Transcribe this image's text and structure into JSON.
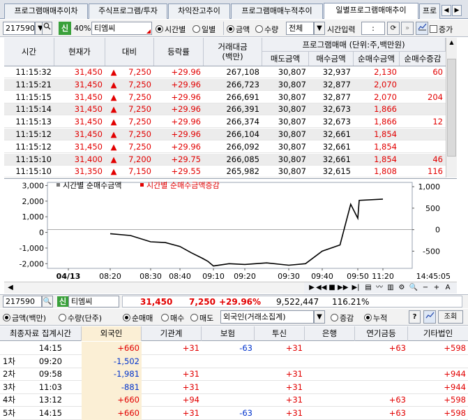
{
  "tabs": [
    {
      "label": "프로그램매매추이차"
    },
    {
      "label": "주식프로그램/투자"
    },
    {
      "label": "차익잔고추이"
    },
    {
      "label": "프로그램매매누적추이"
    },
    {
      "label": "일별프로그램매매추이"
    },
    {
      "label": "프로"
    }
  ],
  "toolbar": {
    "stock_code": "217590",
    "credit_badge": "신",
    "margin": "40%",
    "stock_name": "티엠씨",
    "view_by_time": "시간별",
    "view_by_day": "일별",
    "unit_amount": "금액",
    "unit_qty": "수량",
    "market_select": "전체",
    "time_input_label": "시간입력",
    "time_input_value": ":",
    "increase_label": "증가"
  },
  "table": {
    "headers": {
      "time": "시간",
      "price": "현재가",
      "change": "대비",
      "rate": "등락률",
      "value": "거래대금\n(백만)",
      "program_group": "프로그램매매 (단위:주,백만원)",
      "sell": "매도금액",
      "buy": "매수금액",
      "net": "순매수금액",
      "net_delta": "순매수증감"
    },
    "rows": [
      {
        "time": "11:15:32",
        "price": "31,450",
        "arrow": "▲",
        "change": "7,250",
        "rate": "+29.96",
        "value": "267,108",
        "sell": "30,807",
        "buy": "32,937",
        "net": "2,130",
        "delta": "60"
      },
      {
        "time": "11:15:21",
        "price": "31,450",
        "arrow": "▲",
        "change": "7,250",
        "rate": "+29.96",
        "value": "266,723",
        "sell": "30,807",
        "buy": "32,877",
        "net": "2,070",
        "delta": ""
      },
      {
        "time": "11:15:15",
        "price": "31,450",
        "arrow": "▲",
        "change": "7,250",
        "rate": "+29.96",
        "value": "266,691",
        "sell": "30,807",
        "buy": "32,877",
        "net": "2,070",
        "delta": "204"
      },
      {
        "time": "11:15:14",
        "price": "31,450",
        "arrow": "▲",
        "change": "7,250",
        "rate": "+29.96",
        "value": "266,391",
        "sell": "30,807",
        "buy": "32,673",
        "net": "1,866",
        "delta": ""
      },
      {
        "time": "11:15:13",
        "price": "31,450",
        "arrow": "▲",
        "change": "7,250",
        "rate": "+29.96",
        "value": "266,374",
        "sell": "30,807",
        "buy": "32,673",
        "net": "1,866",
        "delta": "12"
      },
      {
        "time": "11:15:12",
        "price": "31,450",
        "arrow": "▲",
        "change": "7,250",
        "rate": "+29.96",
        "value": "266,104",
        "sell": "30,807",
        "buy": "32,661",
        "net": "1,854",
        "delta": ""
      },
      {
        "time": "11:15:12",
        "price": "31,450",
        "arrow": "▲",
        "change": "7,250",
        "rate": "+29.96",
        "value": "266,092",
        "sell": "30,807",
        "buy": "32,661",
        "net": "1,854",
        "delta": ""
      },
      {
        "time": "11:15:10",
        "price": "31,400",
        "arrow": "▲",
        "change": "7,200",
        "rate": "+29.75",
        "value": "266,085",
        "sell": "30,807",
        "buy": "32,661",
        "net": "1,854",
        "delta": "46"
      },
      {
        "time": "11:15:10",
        "price": "31,350",
        "arrow": "▲",
        "change": "7,150",
        "rate": "+29.55",
        "value": "265,982",
        "sell": "30,807",
        "buy": "32,615",
        "net": "1,808",
        "delta": "116"
      }
    ]
  },
  "chart_data": {
    "type": "line",
    "legend": [
      "시간별 순매수금액",
      "시간별 순매수금액증감"
    ],
    "y_left_ticks": [
      "3,000",
      "2,000",
      "1,000",
      "0",
      "-1,000",
      "-2,000"
    ],
    "y_right_ticks": [
      "1,000",
      "500",
      "0",
      "-500"
    ],
    "x_ticks": [
      "04/13",
      "08:20",
      "08:30",
      "08:40",
      "09:10",
      "09:20",
      "09:30",
      "09:40",
      "09:50",
      "11:20"
    ],
    "x_end_label": "14:45:05",
    "net_buy_line": {
      "x": [
        "08:20",
        "08:25",
        "08:30",
        "08:35",
        "08:40",
        "08:50",
        "09:00",
        "09:05",
        "09:10",
        "09:15",
        "09:20",
        "09:25",
        "09:30",
        "09:35",
        "09:40",
        "09:45",
        "09:48",
        "09:50",
        "09:55",
        "11:20"
      ],
      "y": [
        -80,
        -200,
        -600,
        -650,
        -900,
        -1300,
        -1650,
        -1850,
        -2150,
        -2000,
        -2050,
        -1950,
        -2100,
        -2000,
        -1200,
        -800,
        1800,
        900,
        2050,
        2130
      ]
    },
    "ylim_left": [
      -2300,
      3200
    ],
    "ylim_right": [
      -900,
      1100
    ]
  },
  "summary_bar": {
    "stock_code": "217590",
    "credit_badge": "신",
    "stock_name": "티엠씨",
    "price": "31,450",
    "change": "7,250",
    "rate": "+29.96%",
    "volume": "9,522,447",
    "ratio": "116.21%"
  },
  "controls2": {
    "amount_unit": "금액(백만)",
    "qty_unit": "수량(단주)",
    "net_buy": "순매매",
    "buy": "매수",
    "sell": "매도",
    "investor_select": "외국인(거래소집계)",
    "change_mode": "증감",
    "cumulative_mode": "누적",
    "help": "?",
    "query": "조회"
  },
  "table2": {
    "headers": [
      "최종자료 집계시간",
      "외국인",
      "기관계",
      "보험",
      "투신",
      "은행",
      "연기금등",
      "기타법인"
    ],
    "rows": [
      {
        "label": "",
        "time": "14:15",
        "values": [
          "+660",
          "+31",
          "-63",
          "+31",
          "",
          "+63",
          "+598"
        ]
      },
      {
        "label": "1차",
        "time": "09:20",
        "values": [
          "-1,502",
          "",
          "",
          "",
          "",
          "",
          ""
        ]
      },
      {
        "label": "2차",
        "time": "09:58",
        "values": [
          "-1,981",
          "+31",
          "",
          "+31",
          "",
          "",
          "+944"
        ]
      },
      {
        "label": "3차",
        "time": "11:03",
        "values": [
          "-881",
          "+31",
          "",
          "+31",
          "",
          "",
          "+944"
        ]
      },
      {
        "label": "4차",
        "time": "13:12",
        "values": [
          "+660",
          "+94",
          "",
          "+31",
          "",
          "+63",
          "+598"
        ]
      },
      {
        "label": "5차",
        "time": "14:15",
        "values": [
          "+660",
          "+31",
          "-63",
          "+31",
          "",
          "+63",
          "+598"
        ]
      }
    ]
  }
}
